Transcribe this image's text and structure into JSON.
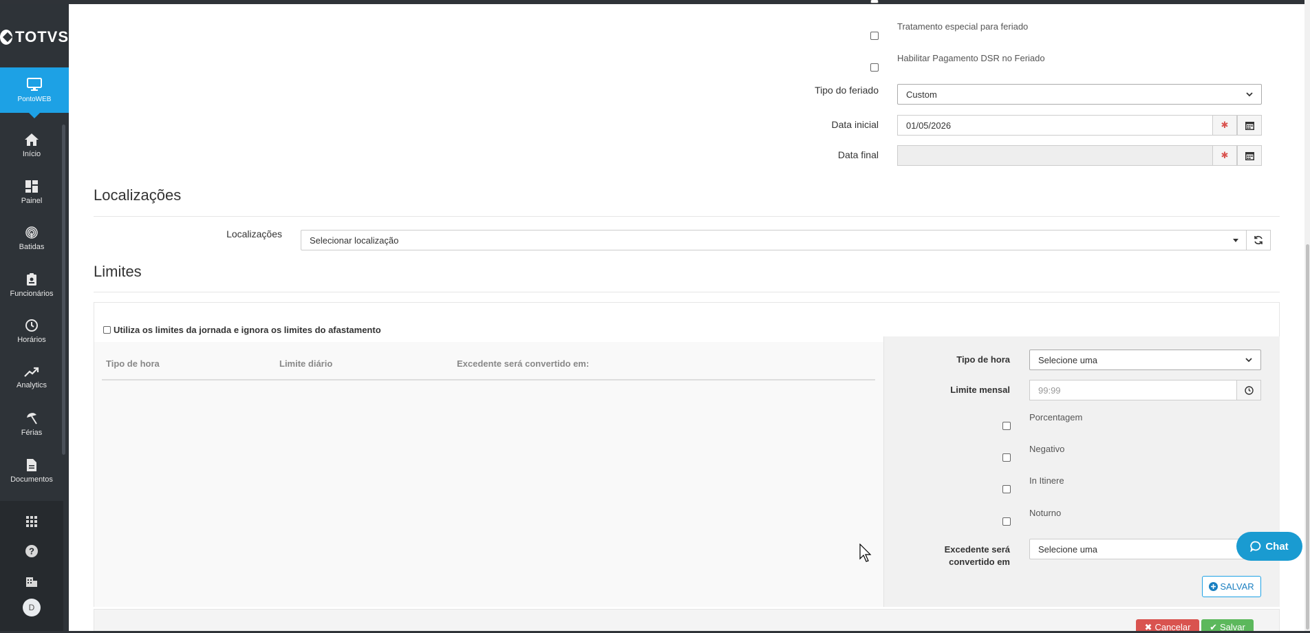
{
  "brand": {
    "logo_text": "TOTVS"
  },
  "product": {
    "label": "PontoWEB",
    "icon": "monitor-icon"
  },
  "nav": [
    {
      "label": "Início",
      "icon": "home-icon"
    },
    {
      "label": "Painel",
      "icon": "dashboard-icon"
    },
    {
      "label": "Batidas",
      "icon": "fingerprint-icon"
    },
    {
      "label": "Funcionários",
      "icon": "badge-icon"
    },
    {
      "label": "Horários",
      "icon": "clock-icon"
    },
    {
      "label": "Analytics",
      "icon": "trend-icon"
    },
    {
      "label": "Férias",
      "icon": "umbrella-icon"
    },
    {
      "label": "Documentos",
      "icon": "document-icon"
    }
  ],
  "bottom_nav": {
    "apps_icon": "apps-grid-icon",
    "help_icon": "help-icon",
    "company_icon": "building-icon",
    "avatar": "D"
  },
  "holiday": {
    "special_treatment_label": "Tratamento especial para feriado",
    "dsr_label": "Habilitar Pagamento DSR no Feriado",
    "tipo_label": "Tipo do feriado",
    "tipo_value": "Custom",
    "data_inicial_label": "Data inicial",
    "data_inicial_value": "01/05/2026",
    "data_final_label": "Data final",
    "data_final_value": "",
    "required_symbol": "✱"
  },
  "locations": {
    "section_title": "Localizações",
    "field_label": "Localizações",
    "select_value": "Selecionar localização"
  },
  "limits": {
    "section_title": "Limites",
    "use_journey_limits_label": "Utiliza os limites da jornada e ignora os limites do afastamento",
    "table_headers": [
      "Tipo de hora",
      "Limite diário",
      "Excedente será convertido em:"
    ],
    "rows": [],
    "form": {
      "tipo_hora_label": "Tipo de hora",
      "tipo_hora_value": "Selecione uma",
      "limite_mensal_label": "Limite mensal",
      "limite_mensal_placeholder": "99:99",
      "porcentagem_label": "Porcentagem",
      "negativo_label": "Negativo",
      "in_itinere_label": "In Itinere",
      "noturno_label": "Noturno",
      "excedente_label_line1": "Excedente será",
      "excedente_label_line2": "convertido em",
      "excedente_value": "Selecione uma",
      "salvar_label": "SALVAR"
    }
  },
  "chat": {
    "label": "Chat"
  },
  "footer": {
    "cancel_label": "Cancelar",
    "save_label": "Salvar"
  }
}
